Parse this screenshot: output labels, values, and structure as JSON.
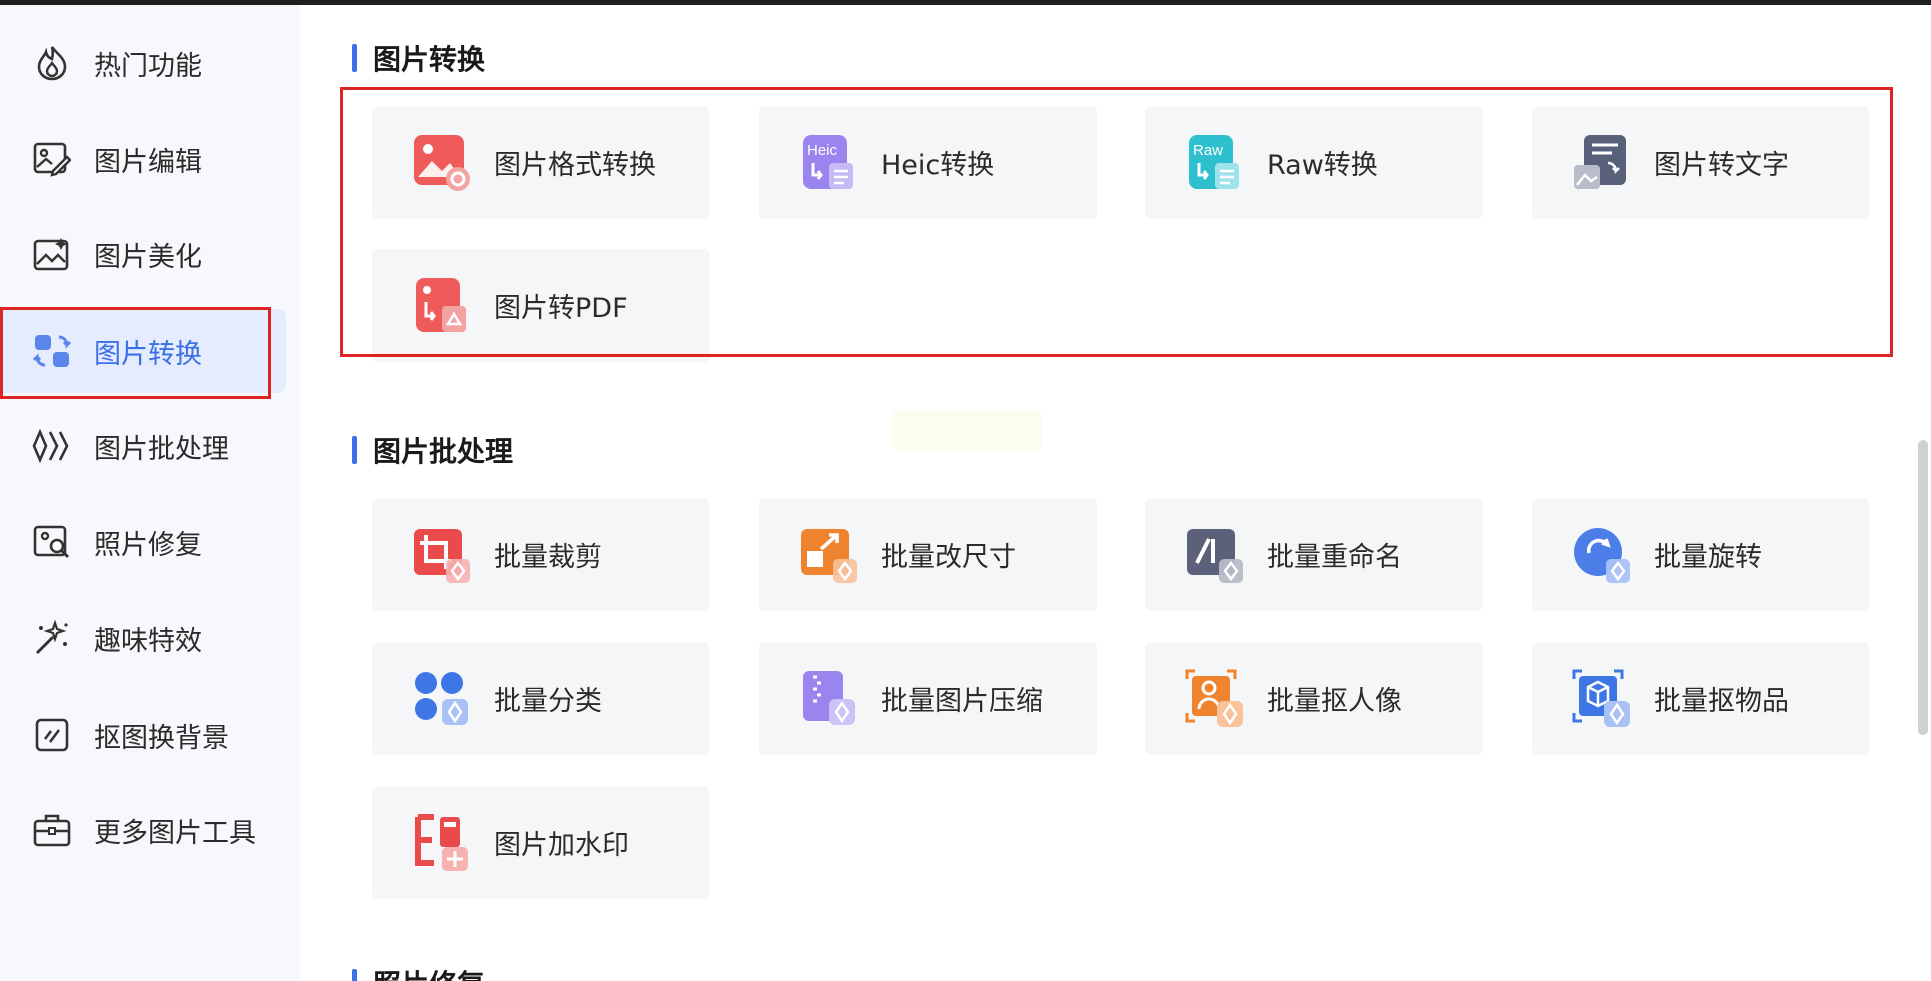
{
  "sidebar": {
    "items": [
      {
        "label": "热门功能",
        "icon": "fire-icon"
      },
      {
        "label": "图片编辑",
        "icon": "image-edit-icon"
      },
      {
        "label": "图片美化",
        "icon": "image-beautify-icon"
      },
      {
        "label": "图片转换",
        "icon": "image-convert-icon",
        "active": true
      },
      {
        "label": "图片批处理",
        "icon": "batch-process-icon"
      },
      {
        "label": "照片修复",
        "icon": "photo-repair-icon"
      },
      {
        "label": "趣味特效",
        "icon": "magic-wand-icon"
      },
      {
        "label": "抠图换背景",
        "icon": "cutout-icon"
      },
      {
        "label": "更多图片工具",
        "icon": "toolbox-icon"
      }
    ]
  },
  "sections": {
    "convert": {
      "title": "图片转换",
      "items": [
        {
          "label": "图片格式转换",
          "icon": "image-format-icon"
        },
        {
          "label": "Heic转换",
          "icon": "heic-icon",
          "icon_text": "Heic"
        },
        {
          "label": "Raw转换",
          "icon": "raw-icon",
          "icon_text": "Raw"
        },
        {
          "label": "图片转文字",
          "icon": "image-to-text-icon"
        },
        {
          "label": "图片转PDF",
          "icon": "image-to-pdf-icon"
        }
      ]
    },
    "batch": {
      "title": "图片批处理",
      "items": [
        {
          "label": "批量裁剪",
          "icon": "batch-crop-icon"
        },
        {
          "label": "批量改尺寸",
          "icon": "batch-resize-icon"
        },
        {
          "label": "批量重命名",
          "icon": "batch-rename-icon"
        },
        {
          "label": "批量旋转",
          "icon": "batch-rotate-icon"
        },
        {
          "label": "批量分类",
          "icon": "batch-classify-icon"
        },
        {
          "label": "批量图片压缩",
          "icon": "batch-compress-icon"
        },
        {
          "label": "批量抠人像",
          "icon": "batch-portrait-cutout-icon"
        },
        {
          "label": "批量抠物品",
          "icon": "batch-object-cutout-icon"
        },
        {
          "label": "图片加水印",
          "icon": "watermark-icon"
        }
      ]
    },
    "repair": {
      "title": "照片修复"
    }
  },
  "colors": {
    "accent": "#3d6fe6",
    "highlight_box": "#e02424",
    "card_bg": "#f5f6f8",
    "sidebar_bg": "#f6f8fb"
  }
}
